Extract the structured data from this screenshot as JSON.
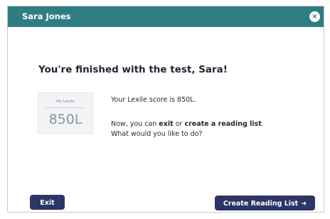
{
  "header": {
    "user_name": "Sara Jones",
    "close_glyph": "×",
    "bar_color": "#2f7d83"
  },
  "main": {
    "heading": "You're finished with the test, Sara!",
    "lexile_card": {
      "label": "My Lexile",
      "score": "850L"
    },
    "score_message": "Your Lexile score is 850L.",
    "next_steps": {
      "prefix": "Now, you can ",
      "exit_word": "exit",
      "middle": " or ",
      "create_phrase": "create a reading list",
      "suffix": ".",
      "question": "What would you like to do?"
    }
  },
  "footer": {
    "exit_label": "Exit",
    "create_label": "Create Reading List",
    "create_arrow": "➜",
    "button_color": "#2b3566"
  }
}
